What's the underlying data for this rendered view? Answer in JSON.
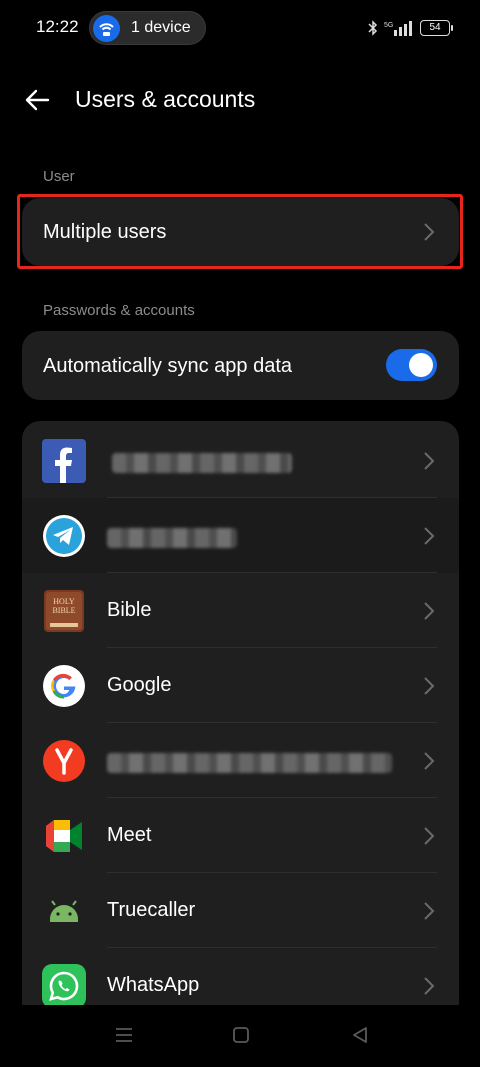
{
  "status_bar": {
    "time": "12:22",
    "device_pill": "1 device",
    "battery": "54"
  },
  "header": {
    "title": "Users & accounts"
  },
  "user_section": {
    "label": "User",
    "multiple_users_label": "Multiple users"
  },
  "passwords_section": {
    "label": "Passwords & accounts",
    "auto_sync_label": "Automatically sync app data",
    "auto_sync_on": true
  },
  "accounts": [
    {
      "icon": "facebook-icon",
      "name": ""
    },
    {
      "icon": "telegram-icon",
      "name": ""
    },
    {
      "icon": "bible-icon",
      "name": "Bible"
    },
    {
      "icon": "google-icon",
      "name": "Google"
    },
    {
      "icon": "yandex-icon",
      "name": ""
    },
    {
      "icon": "meet-icon",
      "name": "Meet"
    },
    {
      "icon": "android-icon",
      "name": "Truecaller"
    },
    {
      "icon": "whatsapp-icon",
      "name": "WhatsApp"
    }
  ],
  "colors": {
    "accent": "#1a6bea",
    "highlight": "#e8251b",
    "card": "#1f1f1f"
  }
}
